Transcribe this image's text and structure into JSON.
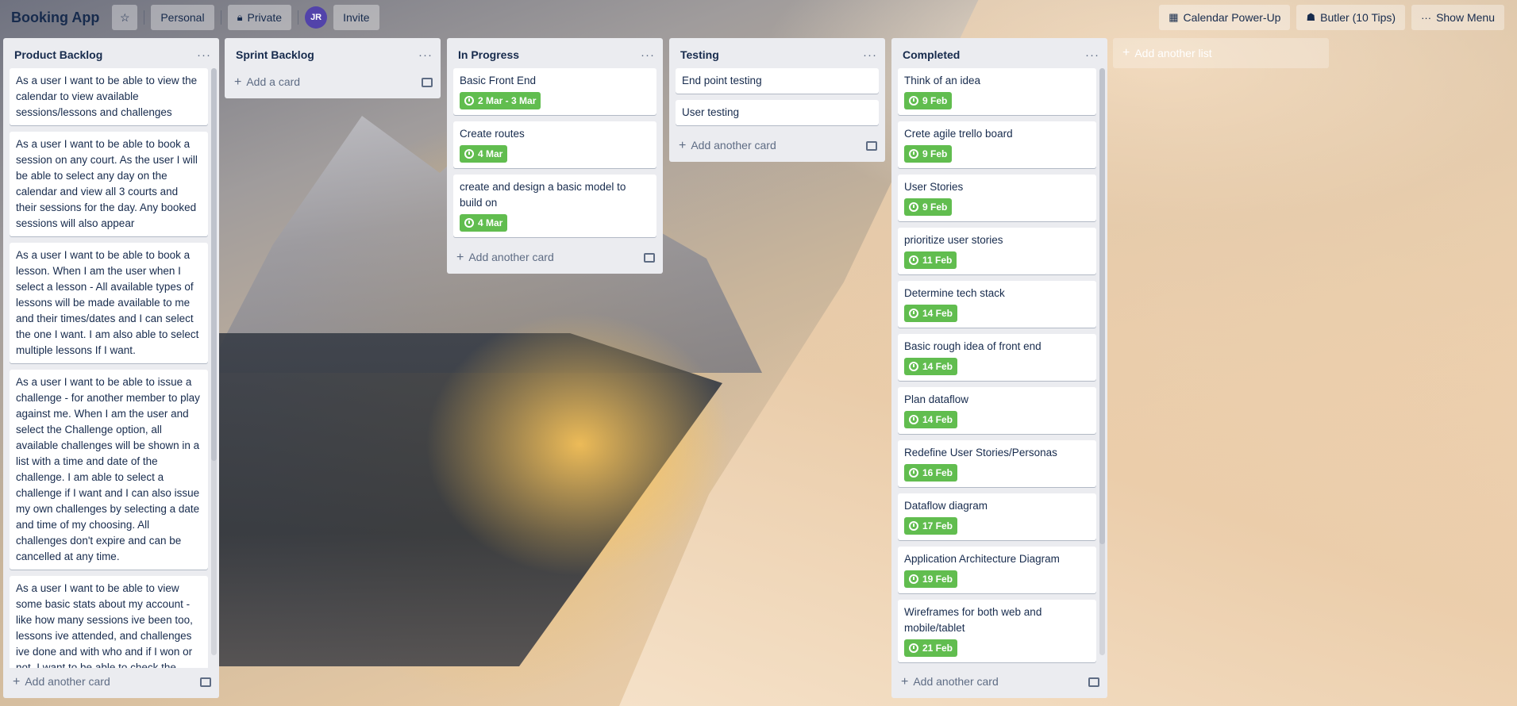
{
  "header": {
    "board_title": "Booking App",
    "workspace_label": "Personal",
    "visibility_label": "Private",
    "avatar_initials": "JR",
    "invite_label": "Invite",
    "calendar_label": "Calendar Power-Up",
    "butler_label": "Butler (10 Tips)",
    "menu_label": "Show Menu"
  },
  "lists": [
    {
      "title": "Product Backlog",
      "add_label": "Add another card",
      "cards": [
        {
          "text": "As a user I want to be able to view the calendar to view available sessions/lessons and challenges"
        },
        {
          "text": "As a user I want to be able to book a session on any court. As the user I will be able to select any day on the calendar and view all 3 courts and their sessions for the day. Any booked sessions will also appear"
        },
        {
          "text": "As a user I want to be able to book a lesson. When I am the user when I select a lesson - All available types of lessons will be made available to me and their times/dates and I can select the one I want. I am also able to select multiple lessons If I want."
        },
        {
          "text": "As a user I want to be able to issue a challenge - for another member to play against me. When I am the user and select the Challenge option, all available challenges will be shown in a list with a time and date of the challenge. I am able to select a challenge if I want and I can also issue my own challenges by selecting a date and time of my choosing. All challenges don't expire and can be cancelled at any time."
        },
        {
          "text": "As a user I want to be able to view some basic stats about my account - like how many sessions ive been too, lessons ive attended, and challenges ive done and with who and if I won or not. I want to be able to check the"
        }
      ]
    },
    {
      "title": "Sprint Backlog",
      "add_label": "Add a card",
      "cards": []
    },
    {
      "title": "In Progress",
      "add_label": "Add another card",
      "cards": [
        {
          "text": "Basic Front End",
          "due": "2 Mar - 3 Mar"
        },
        {
          "text": "Create routes",
          "due": "4 Mar"
        },
        {
          "text": "create and design a basic model to build on",
          "due": "4 Mar"
        }
      ]
    },
    {
      "title": "Testing",
      "add_label": "Add another card",
      "cards": [
        {
          "text": "End point testing"
        },
        {
          "text": "User testing"
        }
      ]
    },
    {
      "title": "Completed",
      "add_label": "Add another card",
      "cards": [
        {
          "text": "Think of an idea",
          "due": "9 Feb"
        },
        {
          "text": "Crete agile trello board",
          "due": "9 Feb"
        },
        {
          "text": "User Stories",
          "due": "9 Feb"
        },
        {
          "text": "prioritize user stories",
          "due": "11 Feb"
        },
        {
          "text": "Determine tech stack",
          "due": "14 Feb"
        },
        {
          "text": "Basic rough idea of front end",
          "due": "14 Feb"
        },
        {
          "text": "Plan dataflow",
          "due": "14 Feb"
        },
        {
          "text": "Redefine User Stories/Personas",
          "due": "16 Feb"
        },
        {
          "text": "Dataflow diagram",
          "due": "17 Feb"
        },
        {
          "text": "Application Architecture Diagram",
          "due": "19 Feb"
        },
        {
          "text": "Wireframes for both web and mobile/tablet",
          "due": "21 Feb"
        }
      ]
    }
  ],
  "add_list_label": "Add another list",
  "colors": {
    "due_complete": "#61bd4f",
    "list_bg": "#ebecf0",
    "text": "#172b4d"
  }
}
